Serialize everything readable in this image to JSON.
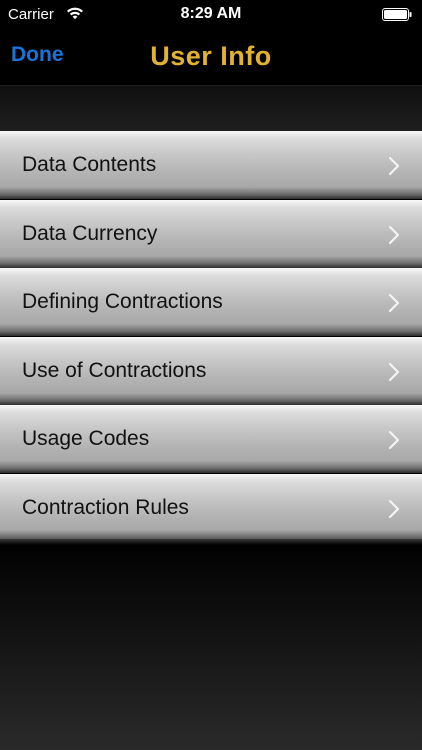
{
  "status_bar": {
    "carrier": "Carrier",
    "time": "8:29 AM",
    "icons": [
      "wifi-icon",
      "battery-icon"
    ]
  },
  "nav": {
    "done_label": "Done",
    "title": "User Info"
  },
  "colors": {
    "done_blue": "#1a73d9",
    "title_gold": "#e3b232",
    "row_gradient_top": "#f4f4f4",
    "row_gradient_bottom": "#a8a8a8"
  },
  "menu": {
    "items": [
      {
        "label": "Data Contents",
        "icon": "chevron-right-icon"
      },
      {
        "label": "Data Currency",
        "icon": "chevron-right-icon"
      },
      {
        "label": "Defining Contractions",
        "icon": "chevron-right-icon"
      },
      {
        "label": "Use of Contractions",
        "icon": "chevron-right-icon"
      },
      {
        "label": "Usage Codes",
        "icon": "chevron-right-icon"
      },
      {
        "label": "Contraction Rules",
        "icon": "chevron-right-icon"
      }
    ]
  }
}
